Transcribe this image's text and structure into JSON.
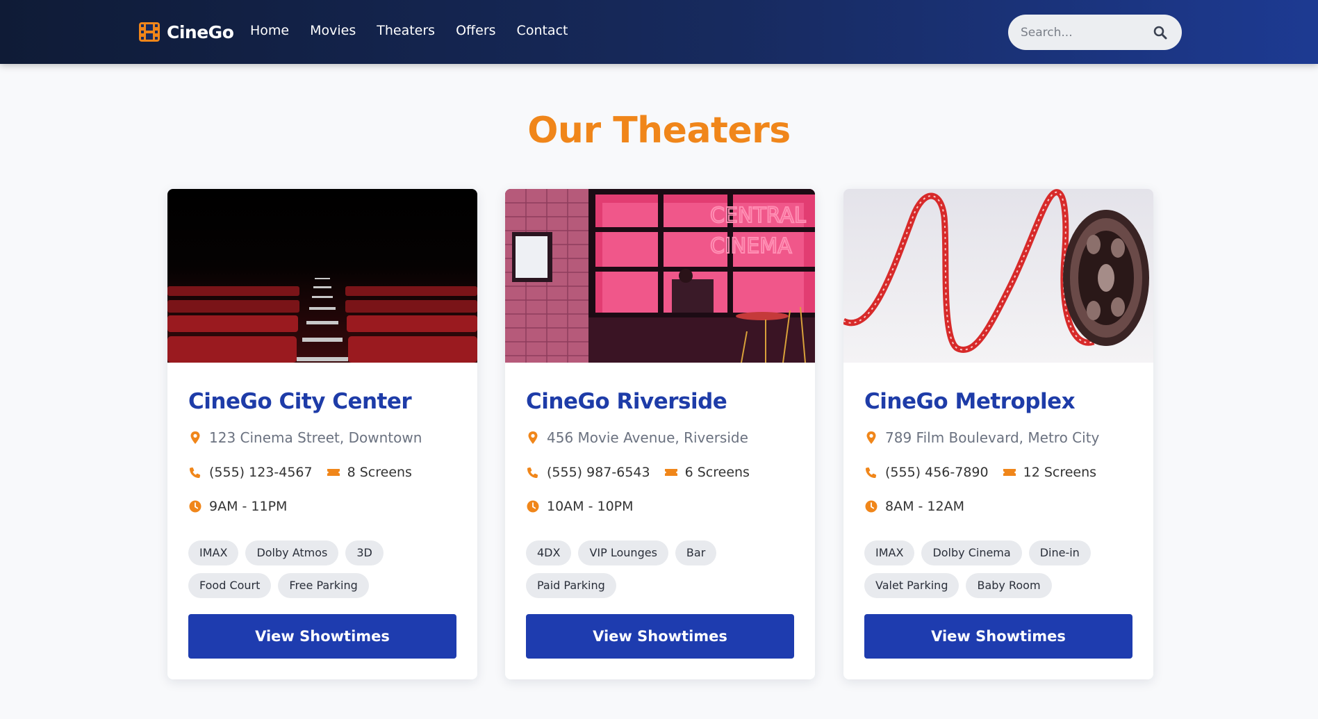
{
  "header": {
    "brand": "CineGo",
    "nav": [
      "Home",
      "Movies",
      "Theaters",
      "Offers",
      "Contact"
    ],
    "search_placeholder": "Search...",
    "brand_icon": "film-icon",
    "search_icon": "search-icon"
  },
  "page": {
    "title": "Our Theaters"
  },
  "colors": {
    "accent": "#f0861a",
    "primary": "#1e3caf",
    "nav_dark": "#0f1b36"
  },
  "theaters": [
    {
      "name": "CineGo City Center",
      "address": "123 Cinema Street, Downtown",
      "phone": "(555) 123-4567",
      "screens": "8 Screens",
      "hours": "9AM - 11PM",
      "tags": [
        "IMAX",
        "Dolby Atmos",
        "3D",
        "Food Court",
        "Free Parking"
      ],
      "button": "View Showtimes"
    },
    {
      "name": "CineGo Riverside",
      "address": "456 Movie Avenue, Riverside",
      "phone": "(555) 987-6543",
      "screens": "6 Screens",
      "hours": "10AM - 10PM",
      "tags": [
        "4DX",
        "VIP Lounges",
        "Bar",
        "Paid Parking"
      ],
      "button": "View Showtimes",
      "image_text": [
        "CENTRAL",
        "CINEMA"
      ]
    },
    {
      "name": "CineGo Metroplex",
      "address": "789 Film Boulevard, Metro City",
      "phone": "(555) 456-7890",
      "screens": "12 Screens",
      "hours": "8AM - 12AM",
      "tags": [
        "IMAX",
        "Dolby Cinema",
        "Dine-in",
        "Valet Parking",
        "Baby Room"
      ],
      "button": "View Showtimes"
    }
  ]
}
